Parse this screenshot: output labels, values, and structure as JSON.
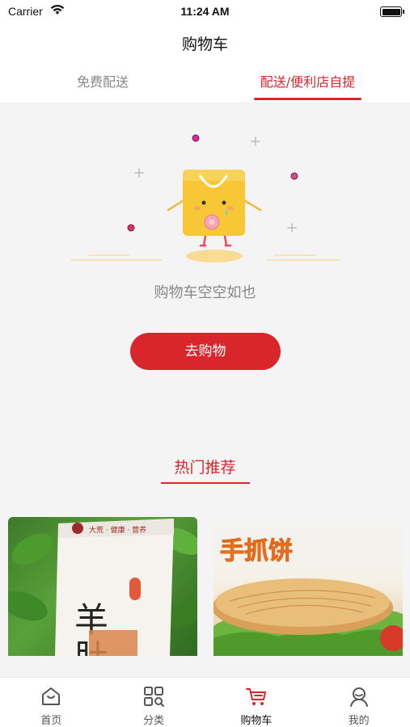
{
  "status_bar": {
    "carrier": "Carrier",
    "time": "11:24 AM"
  },
  "nav": {
    "title": "购物车"
  },
  "tabs": [
    {
      "label": "免费配送",
      "active": false
    },
    {
      "label": "配送/便利店自提",
      "active": true
    }
  ],
  "empty_state": {
    "message": "购物车空空如也",
    "button_label": "去购物"
  },
  "recommend": {
    "title": "热门推荐",
    "products": [
      {
        "package_text": "羊肚菌",
        "brand": "大荒 · 健康 · 营养"
      },
      {
        "package_text": "手抓饼"
      }
    ]
  },
  "tabbar": {
    "items": [
      {
        "label": "首页",
        "icon": "home-icon",
        "active": false
      },
      {
        "label": "分类",
        "icon": "category-icon",
        "active": false
      },
      {
        "label": "购物车",
        "icon": "cart-icon",
        "active": true
      },
      {
        "label": "我的",
        "icon": "profile-icon",
        "active": false
      }
    ]
  },
  "colors": {
    "accent": "#d9262c",
    "background": "#f4f4f4",
    "mascot": "#f7c735"
  }
}
